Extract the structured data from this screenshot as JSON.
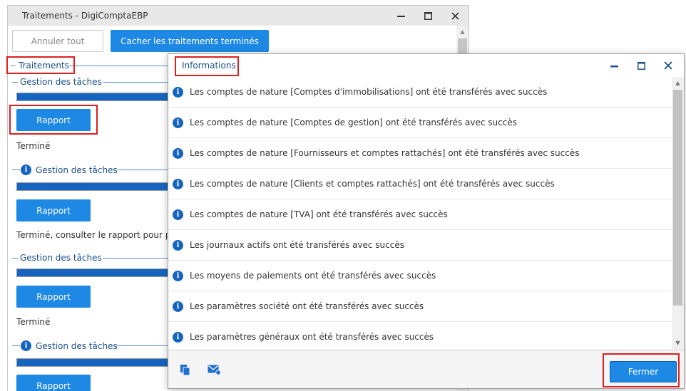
{
  "bg_window": {
    "title": "Traitements - DigiComptaEBP",
    "cancel_all_label": "Annuler tout",
    "hide_done_label": "Cacher les traitements terminés",
    "root_group_label": "Traitements",
    "tasks": [
      {
        "legend": "Gestion des tâches",
        "has_info_icon": false,
        "report_label": "Rapport",
        "status": "Terminé",
        "progress": 1.0
      },
      {
        "legend": "Gestion des tâches",
        "has_info_icon": true,
        "report_label": "Rapport",
        "status": "Terminé, consulter le rapport pour plus",
        "progress": 1.0
      },
      {
        "legend": "Gestion des tâches",
        "has_info_icon": false,
        "report_label": "Rapport",
        "status": "Terminé",
        "progress": 1.0
      },
      {
        "legend": "Gestion des tâches",
        "has_info_icon": true,
        "report_label": "Rapport",
        "status": "",
        "progress": 1.0
      }
    ]
  },
  "dialog": {
    "title": "Informations",
    "messages": [
      "Les comptes de nature [Comptes d'immobilisations] ont été transférés avec succès",
      "Les comptes de nature [Comptes de gestion] ont été transférés avec succès",
      "Les comptes de nature [Fournisseurs et comptes rattachés] ont été transférés avec succès",
      "Les comptes de nature [Clients et comptes rattachés] ont été transférés avec succès",
      "Les comptes de nature [TVA] ont été transférés avec succès",
      "Les journaux actifs ont été transférés avec succès",
      "Les moyens de paiements ont été transférés avec succès",
      "Les paramètres société ont été transférés avec succès",
      "Les paramètres généraux ont été transférés avec succès"
    ],
    "close_label": "Fermer"
  },
  "icons": {
    "info": "info-icon",
    "copy": "copy-icon",
    "mail": "mail-icon",
    "minimize": "minimize-icon",
    "maximize": "maximize-icon",
    "close": "close-icon"
  },
  "colors": {
    "accent": "#1e88e5",
    "progress_fill": "#1565c0",
    "highlight": "#e01e1e",
    "legend_text": "#1a4f8a"
  }
}
